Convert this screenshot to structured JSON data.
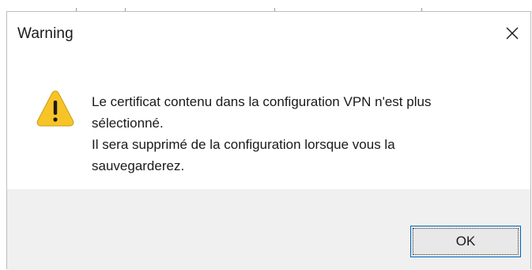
{
  "dialog": {
    "title": "Warning",
    "close_icon": "close-icon",
    "icon": "warning-icon",
    "message_lines": [
      "Le certificat contenu dans la configuration VPN n'est plus",
      "sélectionné.",
      "Il sera supprimé de la configuration lorsque vous la",
      "sauvegarderez."
    ],
    "ok_label": "OK"
  },
  "colors": {
    "warning_fill": "#f7c428",
    "accent_border": "#0067c0",
    "footer_bg": "#f0f0f0"
  }
}
